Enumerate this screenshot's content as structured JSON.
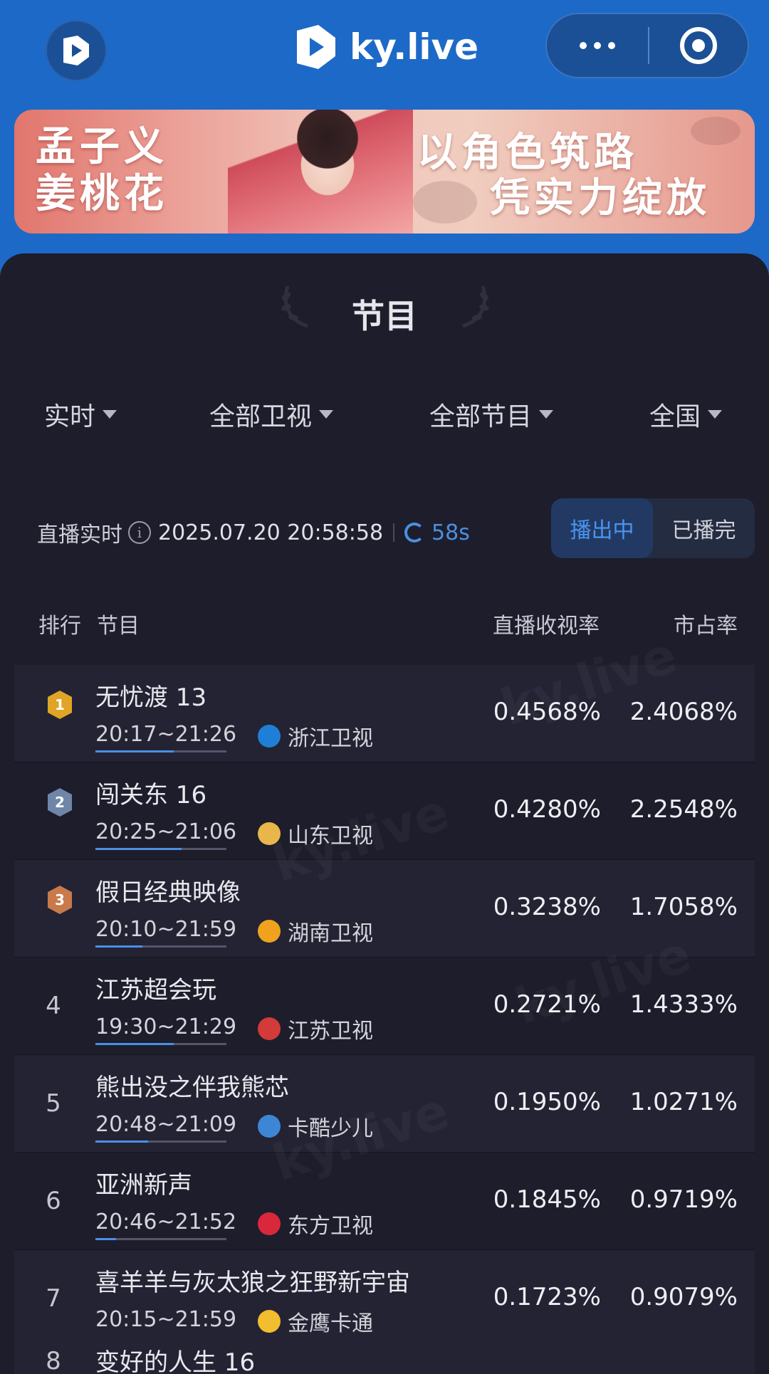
{
  "header": {
    "brand": "ky.live",
    "logo_icon": "ky-live-logo-icon",
    "more_icon": "more-dots-icon",
    "target_icon": "target-icon"
  },
  "banner": {
    "left_line1": "孟子义",
    "left_line2": "姜桃花",
    "right_line1": "以角色筑路",
    "right_line2": "凭实力绽放"
  },
  "panel": {
    "title": "节目"
  },
  "filters": [
    {
      "label": "实时"
    },
    {
      "label": "全部卫视"
    },
    {
      "label": "全部节目"
    },
    {
      "label": "全国"
    }
  ],
  "live": {
    "label": "直播实时",
    "timestamp": "2025.07.20 20:58:58",
    "refresh": "58s"
  },
  "segment": {
    "on": "播出中",
    "off": "已播完"
  },
  "table": {
    "headers": {
      "rank": "排行",
      "program": "节目",
      "rate": "直播收视率",
      "share": "市占率"
    },
    "rows": [
      {
        "rank": "1",
        "name": "无忧渡 13",
        "time": "20:17~21:26",
        "progress": 0.6,
        "channel": "浙江卫视",
        "channel_color": "#1f7fd6",
        "rate": "0.4568%",
        "share": "2.4068%"
      },
      {
        "rank": "2",
        "name": "闯关东 16",
        "time": "20:25~21:06",
        "progress": 0.66,
        "channel": "山东卫视",
        "channel_color": "#e8b64a",
        "rate": "0.4280%",
        "share": "2.2548%"
      },
      {
        "rank": "3",
        "name": "假日经典映像",
        "time": "20:10~21:59",
        "progress": 0.36,
        "channel": "湖南卫视",
        "channel_color": "#f0a21e",
        "rate": "0.3238%",
        "share": "1.7058%"
      },
      {
        "rank": "4",
        "name": "江苏超会玩",
        "time": "19:30~21:29",
        "progress": 0.6,
        "channel": "江苏卫视",
        "channel_color": "#d33a3a",
        "rate": "0.2721%",
        "share": "1.4333%"
      },
      {
        "rank": "5",
        "name": "熊出没之伴我熊芯",
        "time": "20:48~21:09",
        "progress": 0.4,
        "channel": "卡酷少儿",
        "channel_color": "#3d86d6",
        "rate": "0.1950%",
        "share": "1.0271%"
      },
      {
        "rank": "6",
        "name": "亚洲新声",
        "time": "20:46~21:52",
        "progress": 0.16,
        "channel": "东方卫视",
        "channel_color": "#d9283b",
        "rate": "0.1845%",
        "share": "0.9719%"
      },
      {
        "rank": "7",
        "name": "喜羊羊与灰太狼之狂野新宇宙",
        "time": "20:15~21:59",
        "progress": 0.38,
        "channel": "金鹰卡通",
        "channel_color": "#f2bd2e",
        "rate": "0.1723%",
        "share": "0.9079%"
      }
    ],
    "partial": {
      "rank": "8",
      "name": "变好的人生 16"
    }
  },
  "medal_colors": [
    "#e0a526",
    "#6f86a8",
    "#c97a4a"
  ],
  "accent": "#4a94ef"
}
